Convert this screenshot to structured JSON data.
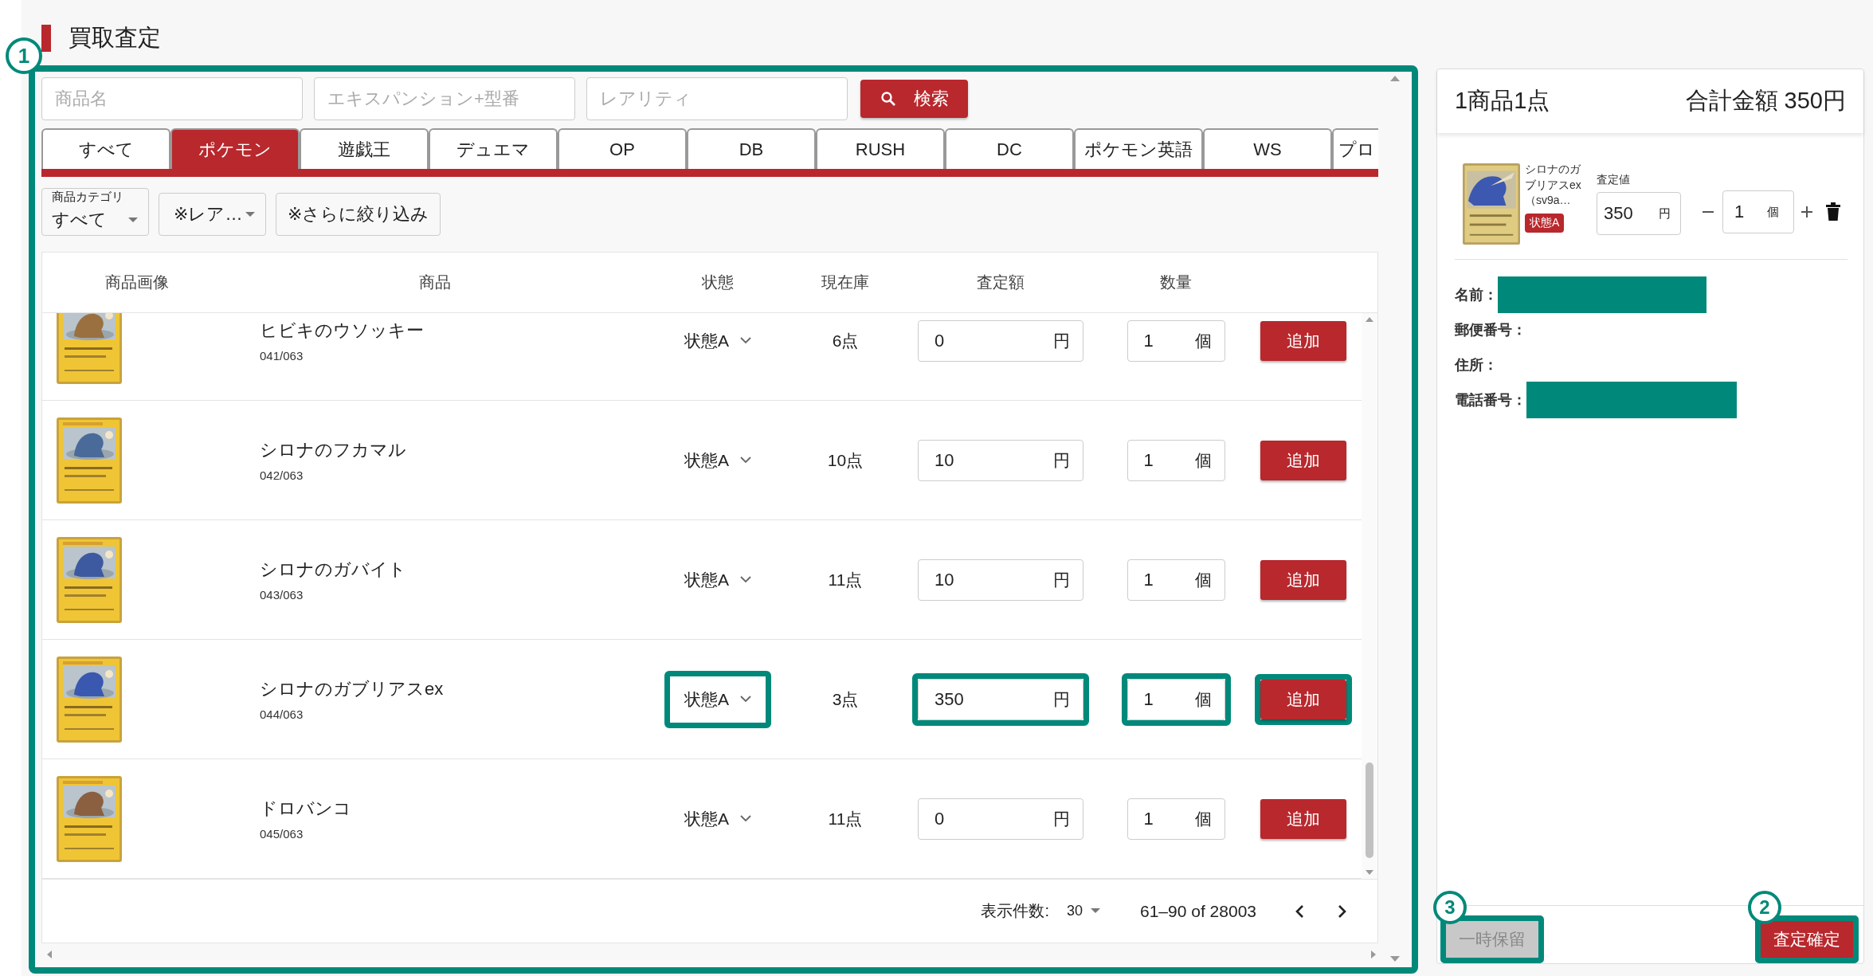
{
  "page_title": "買取査定",
  "search_panel": {
    "callout": "1",
    "highlighted": true,
    "fields": [
      {
        "placeholder": "商品名"
      },
      {
        "placeholder": "エキスパンション+型番"
      },
      {
        "placeholder": "レアリティ"
      }
    ],
    "search_button": "検索",
    "tabs": [
      {
        "label": "すべて",
        "selected": false
      },
      {
        "label": "ポケモン",
        "selected": true
      },
      {
        "label": "遊戯王",
        "selected": false
      },
      {
        "label": "デュエマ",
        "selected": false
      },
      {
        "label": "OP",
        "selected": false
      },
      {
        "label": "DB",
        "selected": false
      },
      {
        "label": "RUSH",
        "selected": false
      },
      {
        "label": "DC",
        "selected": false
      },
      {
        "label": "ポケモン英語",
        "selected": false
      },
      {
        "label": "WS",
        "selected": false
      },
      {
        "label": "プロ",
        "selected": false
      }
    ],
    "filters": {
      "category_label": "商品カテゴリ",
      "category_value": "すべて",
      "rarity": "※レア…",
      "refine": "※さらに絞り込み"
    },
    "table": {
      "columns": [
        "商品画像",
        "商品",
        "状態",
        "現在庫",
        "査定額",
        "数量"
      ],
      "rows": [
        {
          "name": "ヒビキのウソッキー",
          "code": "041/063",
          "condition": "状態A",
          "stock": "6点",
          "price": "0",
          "price_unit": "円",
          "qty": "1",
          "qty_unit": "個",
          "action": "追加",
          "highlighted": false
        },
        {
          "name": "シロナのフカマル",
          "code": "042/063",
          "condition": "状態A",
          "stock": "10点",
          "price": "10",
          "price_unit": "円",
          "qty": "1",
          "qty_unit": "個",
          "action": "追加",
          "highlighted": false
        },
        {
          "name": "シロナのガバイト",
          "code": "043/063",
          "condition": "状態A",
          "stock": "11点",
          "price": "10",
          "price_unit": "円",
          "qty": "1",
          "qty_unit": "個",
          "action": "追加",
          "highlighted": false
        },
        {
          "name": "シロナのガブリアスex",
          "code": "044/063",
          "condition": "状態A",
          "stock": "3点",
          "price": "350",
          "price_unit": "円",
          "qty": "1",
          "qty_unit": "個",
          "action": "追加",
          "highlighted": true
        },
        {
          "name": "ドロバンコ",
          "code": "045/063",
          "condition": "状態A",
          "stock": "11点",
          "price": "0",
          "price_unit": "円",
          "qty": "1",
          "qty_unit": "個",
          "action": "追加",
          "highlighted": false
        }
      ]
    },
    "pagination": {
      "label": "表示件数:",
      "per_page": "30",
      "range": "61–90 of 28003"
    }
  },
  "cart": {
    "summary": "1商品1点",
    "total": "合計金額 350円",
    "items": [
      {
        "name": "シロナのガブリアスex（sv9a…",
        "condition": "状態A",
        "price_label": "査定値",
        "price": "350",
        "price_unit": "円",
        "qty": "1",
        "qty_unit": "個"
      }
    ],
    "info": [
      {
        "label": "名前：",
        "redacted": true
      },
      {
        "label": "郵便番号：",
        "redacted": false
      },
      {
        "label": "住所：",
        "redacted": false
      },
      {
        "label": "電話番号：",
        "redacted": true
      }
    ],
    "hold_button": {
      "label": "一時保留",
      "disabled": true,
      "callout": "3",
      "highlighted": true
    },
    "confirm_button": {
      "label": "査定確定",
      "disabled": false,
      "callout": "2",
      "highlighted": true
    }
  }
}
